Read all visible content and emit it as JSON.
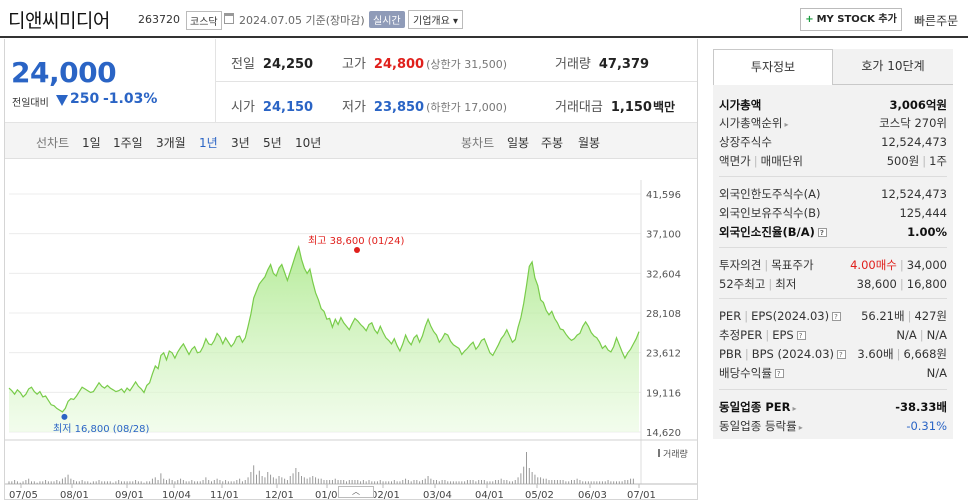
{
  "header": {
    "name": "디앤씨미디어",
    "code": "263720",
    "market": "코스닥",
    "date": "2024.07.05  기준(장마감)",
    "realtime": "실시간",
    "overview": "기업개요 ▾",
    "mystock": "MY STOCK 추가",
    "mystock_plus": "+",
    "quick_order": "빠른주문"
  },
  "price": {
    "current": "24,000",
    "change_label": "전일대비",
    "change": "250",
    "change_pct": "-1.03%",
    "direction": "down",
    "colors": {
      "down": "#2a64c5",
      "up": "#e0201c"
    }
  },
  "stats": {
    "prev_label": "전일",
    "prev": "24,250",
    "high_label": "고가",
    "high": "24,800",
    "upper_limit": "(상한가 31,500)",
    "volume_label": "거래량",
    "volume": "47,379",
    "open_label": "시가",
    "open": "24,150",
    "low_label": "저가",
    "low": "23,850",
    "lower_limit": "(하한가 17,000)",
    "amount_label": "거래대금",
    "amount": "1,150",
    "amount_unit": "백만"
  },
  "periods": {
    "line_label": "선차트",
    "items": [
      "1일",
      "1주일",
      "3개월",
      "1년",
      "3년",
      "5년",
      "10년"
    ],
    "active": "1년",
    "candle_label": "봉차트",
    "candle_items": [
      "일봉",
      "주봉",
      "월봉"
    ]
  },
  "chart_data": {
    "type": "area",
    "ylim": [
      14620,
      41596
    ],
    "y_ticks": [
      "41,596",
      "37,100",
      "32,604",
      "28,108",
      "23,612",
      "19,116",
      "14,620"
    ],
    "x_ticks": [
      "07/05",
      "08/01",
      "09/01",
      "10/04",
      "11/01",
      "12/01",
      "01/02",
      "02/01",
      "03/04",
      "04/01",
      "05/02",
      "06/03",
      "07/01"
    ],
    "max_label": "최고 38,600 (01/24)",
    "min_label": "최저 16,800 (08/28)",
    "volume_label": "거래량",
    "series": [
      {
        "values": [
          19600,
          19300,
          18900,
          19400,
          19100,
          18600,
          18900,
          19500,
          19700,
          19200,
          18900,
          19200,
          18600,
          18700,
          18200,
          17700,
          17600,
          17300,
          17100,
          16900,
          17300,
          18100,
          18400,
          18300,
          18700,
          19200,
          19700,
          19500,
          19300,
          19100,
          19200,
          19700,
          20200,
          19800,
          19600,
          19900,
          19600,
          19400,
          19200,
          19300,
          19500,
          19100,
          19600,
          19300,
          19800,
          20300,
          19800,
          19500,
          19100,
          19900,
          20200,
          21200,
          22100,
          21800,
          23300,
          23600,
          22800,
          23800,
          23600,
          23000,
          23700,
          24200,
          24600,
          24000,
          23400,
          24000,
          24300,
          23600,
          23700,
          24300,
          25200,
          24600,
          24500,
          25000,
          25800,
          25400,
          24600,
          25300,
          24800,
          24300,
          24700,
          25400,
          25500,
          24800,
          25300,
          26600,
          28000,
          29800,
          30600,
          31400,
          31800,
          32200,
          33000,
          33600,
          32600,
          32300,
          33200,
          33600,
          32700,
          31800,
          32800,
          33800,
          34800,
          35600,
          34200,
          33200,
          32600,
          33100,
          31600,
          30400,
          29600,
          28600,
          28300,
          27400,
          27500,
          26500,
          27400,
          26800,
          27600,
          27000,
          26600,
          26200,
          26900,
          27500,
          27200,
          26800,
          26500,
          26100,
          26800,
          27000,
          26200,
          25800,
          26600,
          25900,
          25300,
          25000,
          24600,
          25200,
          24400,
          23800,
          24600,
          25600,
          24900,
          24500,
          25300,
          25600,
          24800,
          25500,
          26600,
          27400,
          26600,
          26000,
          25600,
          24800,
          25200,
          25800,
          25600,
          24900,
          24500,
          24300,
          24100,
          23400,
          23800,
          24100,
          24500,
          24800,
          24000,
          24400,
          25000,
          25200,
          24400,
          23600,
          23300,
          23900,
          24500,
          25200,
          25600,
          26200,
          25500,
          24800,
          25100,
          26500,
          27600,
          29200,
          31200,
          33400,
          33900,
          32100,
          31200,
          29600,
          29300,
          28400,
          27900,
          28300,
          27500,
          27000,
          26300,
          26200,
          25700,
          25300,
          25000,
          25200,
          25600,
          25800,
          26600,
          27100,
          26600,
          25900,
          25500,
          25300,
          24800,
          24100,
          24400,
          23900,
          23700,
          24300,
          25300,
          24500,
          23700,
          23000,
          23600,
          24000,
          24600,
          25200,
          26000
        ]
      }
    ],
    "max_index": 101,
    "min_index": 19,
    "volumes": [
      2,
      2,
      3,
      2,
      1,
      2,
      3,
      4,
      2,
      2,
      1,
      2,
      2,
      3,
      2,
      2,
      2,
      3,
      2,
      4,
      5,
      7,
      4,
      3,
      2,
      2,
      3,
      2,
      2,
      1,
      2,
      2,
      3,
      2,
      2,
      2,
      2,
      1,
      2,
      3,
      2,
      2,
      2,
      2,
      2,
      3,
      2,
      2,
      1,
      2,
      2,
      4,
      5,
      3,
      8,
      4,
      3,
      4,
      3,
      2,
      3,
      4,
      3,
      2,
      2,
      3,
      2,
      2,
      2,
      3,
      5,
      3,
      2,
      3,
      4,
      3,
      2,
      3,
      2,
      2,
      2,
      3,
      4,
      2,
      3,
      5,
      9,
      14,
      7,
      10,
      6,
      5,
      9,
      7,
      5,
      4,
      6,
      5,
      4,
      3,
      6,
      8,
      12,
      9,
      6,
      5,
      4,
      5,
      6,
      5,
      4,
      4,
      3,
      3,
      3,
      3,
      4,
      3,
      3,
      3,
      2,
      3,
      3,
      3,
      3,
      2,
      3,
      2,
      3,
      2,
      2,
      2,
      3,
      2,
      2,
      2,
      2,
      3,
      2,
      2,
      3,
      4,
      3,
      2,
      3,
      3,
      2,
      3,
      4,
      6,
      4,
      3,
      3,
      2,
      3,
      3,
      2,
      2,
      2,
      2,
      2,
      2,
      2,
      3,
      3,
      3,
      2,
      3,
      3,
      3,
      2,
      2,
      2,
      3,
      3,
      4,
      3,
      3,
      2,
      2,
      3,
      5,
      8,
      13,
      24,
      12,
      9,
      7,
      5,
      5,
      4,
      4,
      3,
      3,
      3,
      3,
      3,
      3,
      2,
      2,
      3,
      3,
      4,
      3,
      2,
      2,
      2,
      2,
      2,
      2,
      2,
      2,
      2,
      3,
      2,
      2,
      2,
      2,
      2,
      3,
      3,
      4,
      4
    ]
  },
  "right_panel": {
    "tab_active": "투자정보",
    "tab_other": "호가 10단계",
    "rows": [
      {
        "l": "시가총액",
        "r": "3,006억원",
        "bold": true
      },
      {
        "l": "시가총액순위",
        "r": "코스닥 270위",
        "arrow": true
      },
      {
        "l": "상장주식수",
        "r": "12,524,473"
      },
      {
        "l": "액면가",
        "l2": "매매단위",
        "r": "500원",
        "r2": "1주"
      },
      {
        "l": "외국인한도주식수(A)",
        "r": "12,524,473"
      },
      {
        "l": "외국인보유주식수(B)",
        "r": "125,444"
      },
      {
        "l": "외국인소진율(B/A)",
        "r": "1.00%",
        "bold": true,
        "q": true
      },
      {
        "l": "투자의견",
        "l2": "목표주가",
        "r": "4.00매수",
        "r2": "34,000"
      },
      {
        "l": "52주최고",
        "l2": "최저",
        "r": "38,600",
        "r2": "16,800"
      },
      {
        "l": "PER",
        "l2": "EPS(2024.03)",
        "r": "56.21배",
        "r2": "427원"
      },
      {
        "l": "추정PER",
        "l2": "EPS",
        "r": "N/A",
        "r2": "N/A"
      },
      {
        "l": "PBR",
        "l2": "BPS (2024.03)",
        "r": "3.60배",
        "r2": "6,668원"
      },
      {
        "l": "배당수익률",
        "r": "N/A"
      },
      {
        "l": "동일업종 PER",
        "r": "-38.33배",
        "bold": true
      },
      {
        "l": "동일업종 등락률",
        "r": "-0.31%"
      }
    ]
  },
  "chart_controls": {
    "collapse_icon": "chevron-up"
  }
}
